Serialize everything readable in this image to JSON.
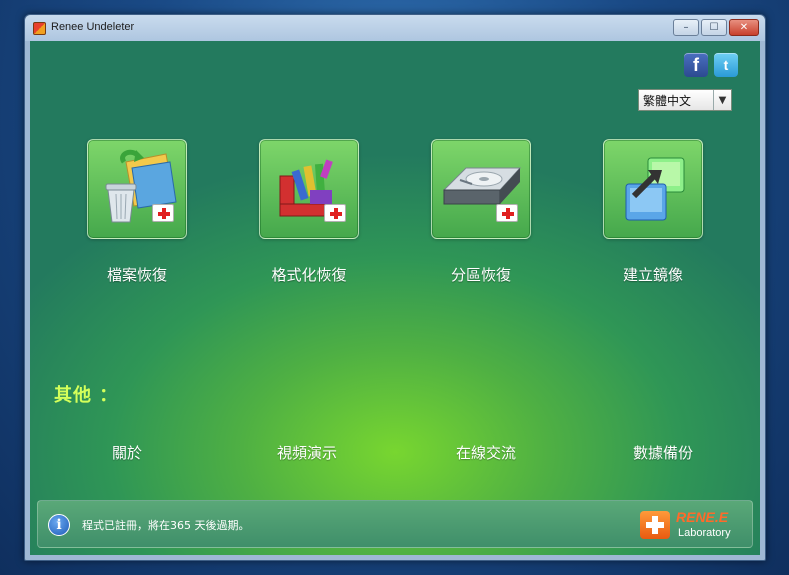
{
  "window": {
    "title": "Renee Undeleter",
    "minimize_glyph": "–",
    "maximize_glyph": "☐",
    "close_glyph": "✕"
  },
  "social": {
    "facebook": "f",
    "twitter": "t"
  },
  "language": {
    "selected": "繁體中文",
    "arrow": "▼"
  },
  "tiles": [
    {
      "label": "檔案恢復",
      "icon": "recycle-bin-file-recovery-icon"
    },
    {
      "label": "格式化恢復",
      "icon": "format-recovery-icon"
    },
    {
      "label": "分區恢復",
      "icon": "hard-drive-partition-icon"
    },
    {
      "label": "建立鏡像",
      "icon": "disk-image-icon"
    }
  ],
  "others": {
    "title": "其他 ：",
    "links": [
      "關於",
      "視頻演示",
      "在線交流",
      "數據備份"
    ]
  },
  "status": {
    "text": "程式已註冊，將在365 天後過期。",
    "info_glyph": "i",
    "logo_name": "RENE.E",
    "logo_sub": "Laboratory"
  },
  "colors": {
    "accent_green": "#4fb043",
    "section_title": "#d4ff5a",
    "logo_orange": "#ff6a2a"
  }
}
